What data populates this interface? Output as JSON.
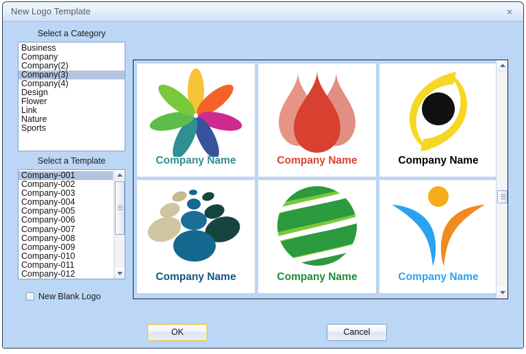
{
  "window": {
    "title": "New Logo Template",
    "close_icon": "close-icon",
    "close_glyph": "×"
  },
  "category": {
    "label": "Select a Category",
    "items": [
      "Business",
      "Company",
      "Company(2)",
      "Company(3)",
      "Company(4)",
      "Design",
      "Flower",
      "Link",
      "Nature",
      "Sports"
    ],
    "selected_index": 3,
    "selected_value": "Company(3)"
  },
  "template": {
    "label": "Select a Template",
    "items": [
      "Company-001",
      "Company-002",
      "Company-003",
      "Company-004",
      "Company-005",
      "Company-006",
      "Company-007",
      "Company-008",
      "Company-009",
      "Company-010",
      "Company-011",
      "Company-012"
    ],
    "selected_index": 0,
    "selected_value": "Company-001",
    "scrollbar": {
      "up_icon": "scroll-up-arrow-icon",
      "down_icon": "scroll-down-arrow-icon",
      "thumb_icon": "scroll-thumb"
    }
  },
  "options": {
    "new_blank_logo_label": "New Blank Logo",
    "new_blank_logo_checked": false
  },
  "preview": {
    "caption_text": "Company Name",
    "scrollbar": {
      "up_icon": "scroll-up-arrow-icon",
      "down_icon": "scroll-down-arrow-icon",
      "thumb_icon": "scroll-thumb"
    },
    "tiles": [
      {
        "id": "logo-flower",
        "icon": "flower-petals-icon",
        "caption": "Company Name",
        "caption_color": "#2e8f8f",
        "colors": [
          "#f6c338",
          "#f4622a",
          "#cf2a8f",
          "#39529c",
          "#2e9090",
          "#5ebc4a",
          "#6ec64a"
        ]
      },
      {
        "id": "logo-droplets",
        "icon": "water-droplets-icon",
        "caption": "Company Name",
        "caption_color": "#d9412f",
        "colors": [
          "#e79487",
          "#d8412f"
        ]
      },
      {
        "id": "logo-eye",
        "icon": "yellow-eye-icon",
        "caption": "Company Name",
        "caption_color": "#000000",
        "colors": [
          "#f6d722",
          "#111111"
        ]
      },
      {
        "id": "logo-pebbles",
        "icon": "pebble-dots-icon",
        "caption": "Company Name",
        "caption_color": "#11587d",
        "colors": [
          "#c2bb93",
          "#15688f",
          "#14463f"
        ]
      },
      {
        "id": "logo-globe",
        "icon": "striped-globe-icon",
        "caption": "Company Name",
        "caption_color": "#1c8b38",
        "colors": [
          "#7ac93b",
          "#2c9a3e"
        ]
      },
      {
        "id": "logo-person",
        "icon": "person-figure-icon",
        "caption": "Company Name",
        "caption_color": "#2aa3ef",
        "colors": [
          "#f7ac1c",
          "#2aa3ef",
          "#f18a21"
        ]
      }
    ]
  },
  "buttons": {
    "ok": "OK",
    "cancel": "Cancel"
  }
}
